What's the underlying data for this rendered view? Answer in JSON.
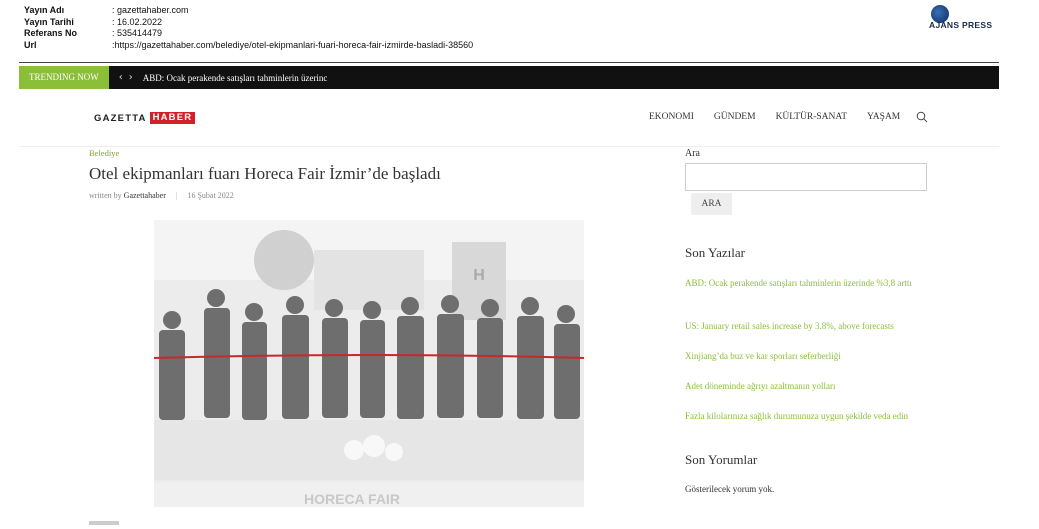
{
  "meta": {
    "rows": [
      {
        "label": "Yayın Adı",
        "value": ": gazettahaber.com"
      },
      {
        "label": "Yayın Tarihi",
        "value": ": 16.02.2022"
      },
      {
        "label": "Referans No",
        "value": ": 535414479"
      },
      {
        "label": "Url",
        "value": ":https://gazettahaber.com/belediye/otel-ekipmanlari-fuari-horeca-fair-izmirde-basladi-38560"
      }
    ],
    "ajans": "AJANS PRESS"
  },
  "trending": {
    "label": "TRENDING NOW",
    "text": "ABD: Ocak perakende satışları tahminlerin üzerinc"
  },
  "logo": {
    "part1": "GAZETTA",
    "part2": "HABER"
  },
  "nav": {
    "items": [
      "EKONOMI",
      "GÜNDEM",
      "KÜLTÜR-SANAT",
      "YAŞAM"
    ]
  },
  "article": {
    "category": "Belediye",
    "title": "Otel ekipmanları fuarı Horeca Fair İzmir’de başladı",
    "written_by": "written by",
    "author": "Gazettahaber",
    "date": "16 Şubat 2022"
  },
  "sidebar": {
    "search_label": "Ara",
    "search_button": "ARA",
    "recent_title": "Son Yazılar",
    "recent_posts": [
      "ABD: Ocak perakende satışları tahminlerin üzerinde %3,8 arttı",
      "US: January retail sales increase by 3.8%, above forecasts",
      "Xinjiang’da buz ve kar sporları seferberliği",
      "Adet döneminde ağrıyı azaltmanın yolları",
      "Fazla kilolarınıza sağlık durumunuza uygun şekilde veda edin"
    ],
    "comments_title": "Son Yorumlar",
    "comments_text": "Gösterilecek yorum yok."
  },
  "photo": {
    "sign_text": "HORECA FAIR"
  },
  "colors": {
    "accent": "#8bbf3a",
    "brand_red": "#d31f2a",
    "bar": "#111111"
  }
}
